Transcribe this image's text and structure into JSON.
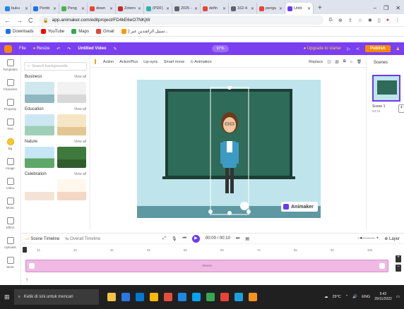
{
  "browser": {
    "tabs": [
      {
        "label": "buku",
        "color": "#1e88e5"
      },
      {
        "label": "Pemb",
        "color": "#1a73e8"
      },
      {
        "label": "Peng",
        "color": "#4caf50"
      },
      {
        "label": "down",
        "color": "#ea4335"
      },
      {
        "label": "Zotero",
        "color": "#c62828"
      },
      {
        "label": "(PDF)",
        "color": "#2db2a8"
      },
      {
        "label": "2025 -",
        "color": "#5f6368"
      },
      {
        "label": "defin",
        "color": "#ea4335"
      },
      {
        "label": "162-4",
        "color": "#5f6368"
      },
      {
        "label": "pengu",
        "color": "#ea4335"
      },
      {
        "label": "Untit",
        "color": "#6b3af0",
        "active": true
      }
    ],
    "new_tab": "+",
    "url": "app.animaker.com/editproject/FD4kE6eO7NKjW",
    "bookmarks": [
      {
        "label": "Downloads",
        "color": "#1a73e8"
      },
      {
        "label": "YouTube",
        "color": "#ff0000"
      },
      {
        "label": "Maps",
        "color": "#34a853"
      },
      {
        "label": "Gmail",
        "color": "#ea4335"
      },
      {
        "label": "سبيل الراشدين عبر إ...",
        "color": "#ff9800"
      }
    ]
  },
  "app": {
    "menu": [
      "File",
      "Resize"
    ],
    "title": "Untitled Video",
    "zoom": "97%",
    "upgrade": "Upgrade to starter",
    "publish": "Publish"
  },
  "rail": [
    {
      "label": "Templates",
      "icon": "templates-icon"
    },
    {
      "label": "Character",
      "icon": "character-icon"
    },
    {
      "label": "Property",
      "icon": "property-icon"
    },
    {
      "label": "Text",
      "icon": "text-icon"
    },
    {
      "label": "Bg",
      "icon": "background-icon",
      "active": true
    },
    {
      "label": "Image",
      "icon": "image-icon"
    },
    {
      "label": "Video",
      "icon": "video-icon"
    },
    {
      "label": "Music",
      "icon": "music-icon"
    },
    {
      "label": "Effect",
      "icon": "effect-icon"
    },
    {
      "label": "Uploads",
      "icon": "upload-icon"
    },
    {
      "label": "More",
      "icon": "more-icon"
    }
  ],
  "library": {
    "search_placeholder": "Search backgrounds",
    "view_all": "View all",
    "categories": [
      "Business",
      "Education",
      "Nature",
      "Celebration"
    ]
  },
  "editor_toolbar": {
    "items": [
      "Action",
      "ActionPlus",
      "Lip-sync",
      "Smart move",
      "Animation"
    ],
    "replace": "Replace"
  },
  "canvas": {
    "watermark": "Animaker"
  },
  "scenes": {
    "title": "Scenes",
    "scene_label": "Scene 1",
    "scene_time": "00:10"
  },
  "timeline": {
    "label": "Scene Timeline",
    "overall": "Overall Timeline",
    "time": "00:00 / 00:10",
    "layer": "Layer",
    "ticks": [
      "1s",
      "2s",
      "3s",
      "4s",
      "5s",
      "6s",
      "7s",
      "8s",
      "9s",
      "10s"
    ],
    "track_label": "Sleeve"
  },
  "taskbar": {
    "search": "Ketik di sini untuk mencari",
    "weather": "29°C",
    "lang": "ENG",
    "time": "9:42",
    "date": "29/11/2022"
  }
}
